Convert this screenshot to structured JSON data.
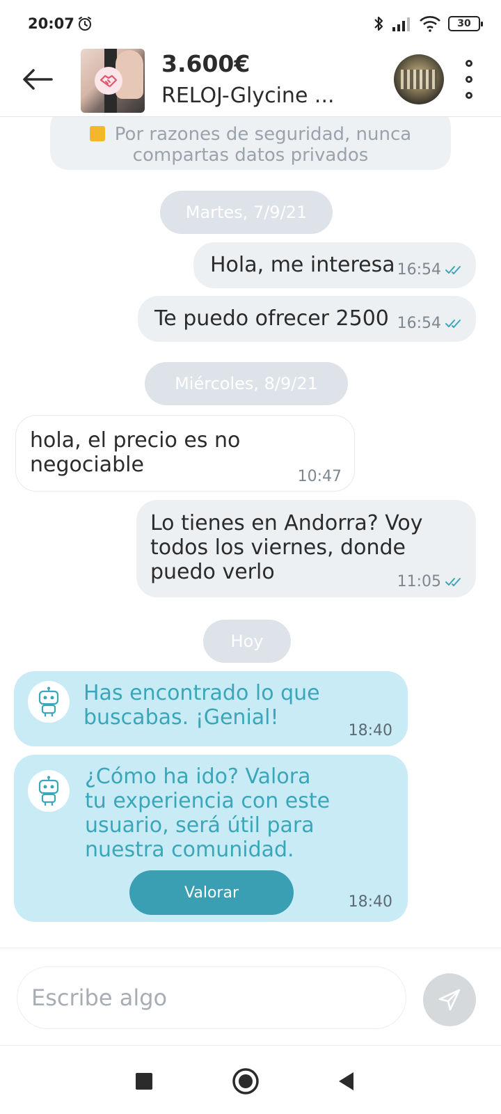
{
  "status_bar": {
    "time": "20:07",
    "battery": "30"
  },
  "header": {
    "price": "3.600€",
    "title": "RELOJ-Glycine ..."
  },
  "chat": {
    "notice": {
      "line1": "Por razones de seguridad, nunca",
      "line2": "compartas datos privados"
    },
    "dates": [
      "Martes, 7/9/21",
      "Miércoles, 8/9/21",
      "Hoy"
    ],
    "messages": [
      {
        "direction": "out",
        "text": "Hola, me interesa",
        "time": "16:54",
        "read": true
      },
      {
        "direction": "out",
        "text": "Te puedo ofrecer 2500",
        "time": "16:54",
        "read": true
      },
      {
        "direction": "in",
        "line1": "hola, el precio es no",
        "line2": "negociable",
        "time": "10:47"
      },
      {
        "direction": "out",
        "line1": "Lo tienes en Andorra? Voy",
        "line2": "todos los viernes, donde",
        "line3": "puedo verlo",
        "time": "11:05",
        "read": true
      }
    ],
    "bot_messages": [
      {
        "line1": "Has encontrado lo que",
        "line2": "buscabas. ¡Genial!",
        "time": "18:40"
      },
      {
        "line1": "¿Cómo ha ido? Valora",
        "line2": "tu experiencia con este",
        "line3": "usuario, será útil para",
        "line4": "nuestra comunidad.",
        "button": "Valorar",
        "time": "18:40"
      }
    ]
  },
  "input": {
    "placeholder": "Escribe algo"
  },
  "colors": {
    "bot_bubble": "#c9ebf5",
    "bot_text": "#3aa6b9",
    "button": "#3a9fb2",
    "read_ticks": "#3aa6b9"
  },
  "icons": [
    "alarm-icon",
    "bluetooth-icon",
    "signal-icon",
    "wifi-icon",
    "battery-icon",
    "back-arrow-icon",
    "handshake-icon",
    "more-icon",
    "lock-icon",
    "double-check-icon",
    "robot-icon",
    "send-icon",
    "nav-recents-icon",
    "nav-home-icon",
    "nav-back-icon"
  ]
}
